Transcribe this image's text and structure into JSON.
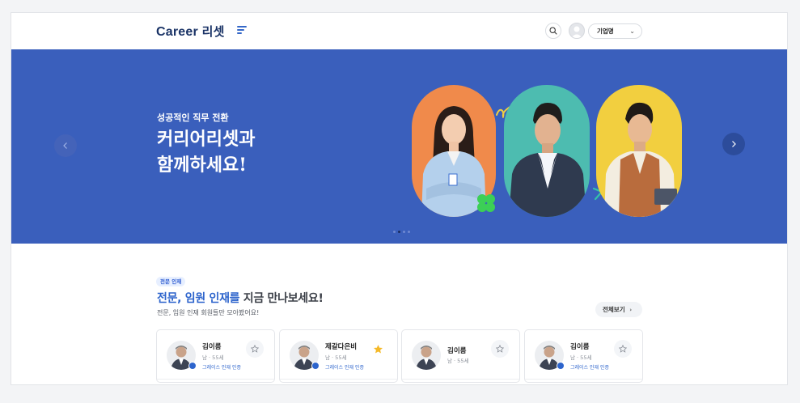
{
  "header": {
    "logo_en": "Career",
    "logo_kr": "리셋",
    "corp_select": "기업명"
  },
  "hero": {
    "subtitle": "성공적인 직무 전환",
    "title_line1": "커리어리셋과",
    "title_line2": "함께하세요!",
    "slide_count": 3,
    "active_slide": 1,
    "colors": {
      "background": "#3a5fbc",
      "pill1": "#f08a4b",
      "pill2": "#4dbcb0",
      "pill3": "#f2cf3f",
      "clover": "#3ccf56"
    }
  },
  "section": {
    "badge": "전문 인재",
    "title_highlight": "전문, 임원 인재를",
    "title_rest": " 지금 만나보세요!",
    "description": "전문, 임원 인재 회원들만 모아봤어요!",
    "view_all": "전체보기"
  },
  "cards": [
    {
      "name": "김이름",
      "meta": "남 · 55세",
      "verified": "그레이스 인재 인증",
      "starred": false
    },
    {
      "name": "제갈다은비",
      "meta": "남 · 55세",
      "verified": "그레이스 인재 인증",
      "starred": true
    },
    {
      "name": "김이름",
      "meta": "남 · 55세",
      "verified": "",
      "starred": false
    },
    {
      "name": "김이름",
      "meta": "남 · 55세",
      "verified": "그레이스 인재 인증",
      "starred": false
    }
  ],
  "icons": [
    "menu-icon",
    "search-icon",
    "user-icon",
    "chevron-down-icon",
    "chevron-left-icon",
    "chevron-right-icon",
    "star-icon",
    "verified-check-icon"
  ]
}
